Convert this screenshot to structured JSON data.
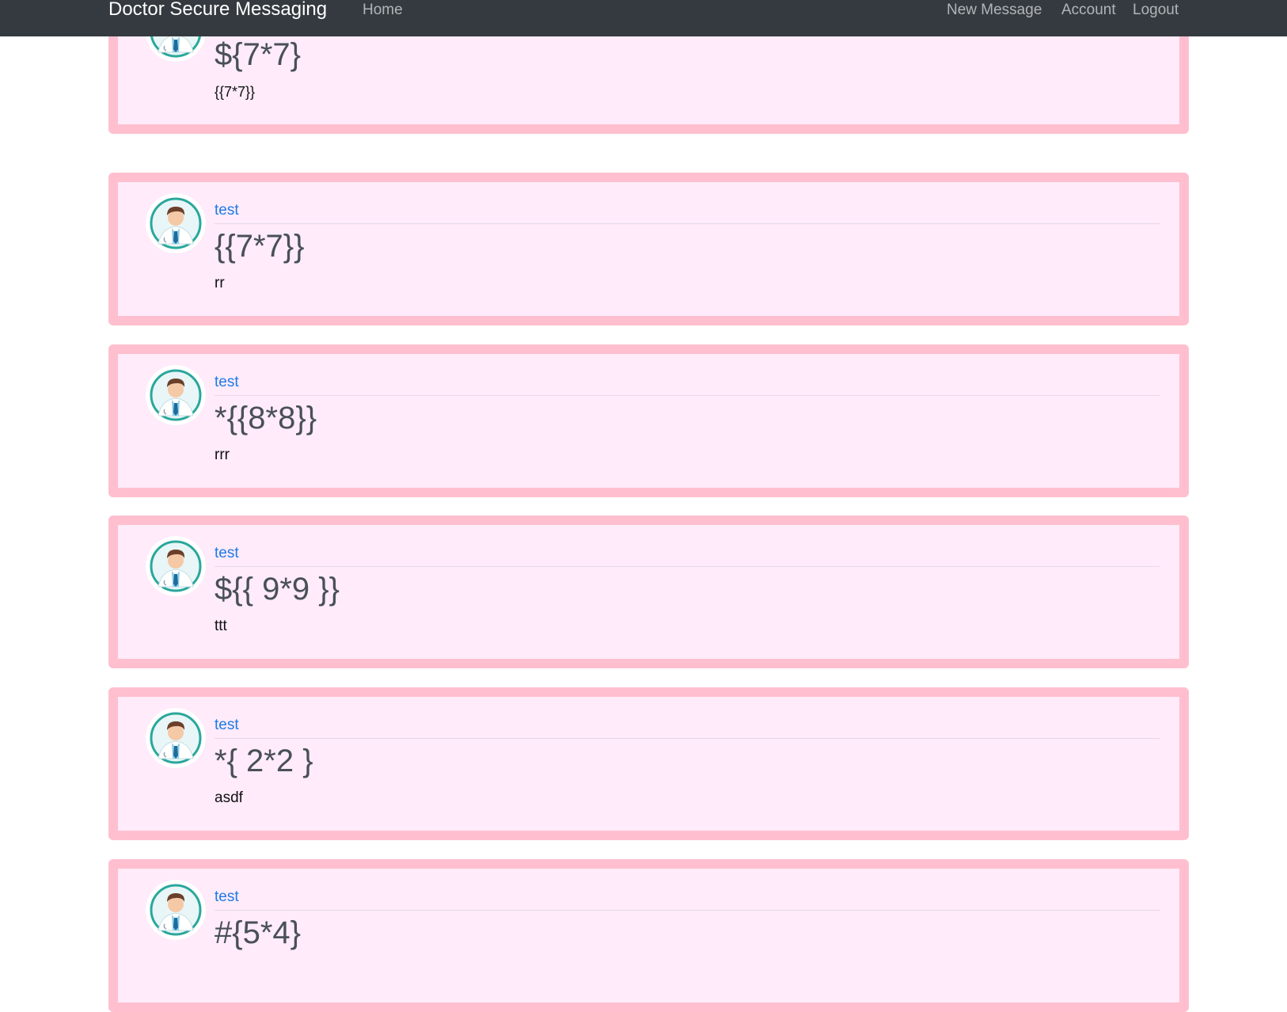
{
  "navbar": {
    "brand": "Doctor Secure Messaging",
    "home": "Home",
    "new_message": "New Message",
    "account": "Account",
    "logout": "Logout"
  },
  "colors": {
    "navbar_bg": "#343a40",
    "card_border": "#ffbfcf",
    "card_bg": "#ffebfa",
    "author_link": "#1e7ae6"
  },
  "avatar_icon": "doctor-avatar-icon",
  "messages": [
    {
      "author": "",
      "title": "${7*7}",
      "content": "{{7*7}}"
    },
    {
      "author": "test",
      "title": "{{7*7}}",
      "content": "rr"
    },
    {
      "author": "test",
      "title": "*{{8*8}}",
      "content": "rrr"
    },
    {
      "author": "test",
      "title": "${{ 9*9 }}",
      "content": "ttt"
    },
    {
      "author": "test",
      "title": "*{ 2*2 }",
      "content": "asdf"
    },
    {
      "author": "test",
      "title": "#{5*4}",
      "content": ""
    }
  ]
}
